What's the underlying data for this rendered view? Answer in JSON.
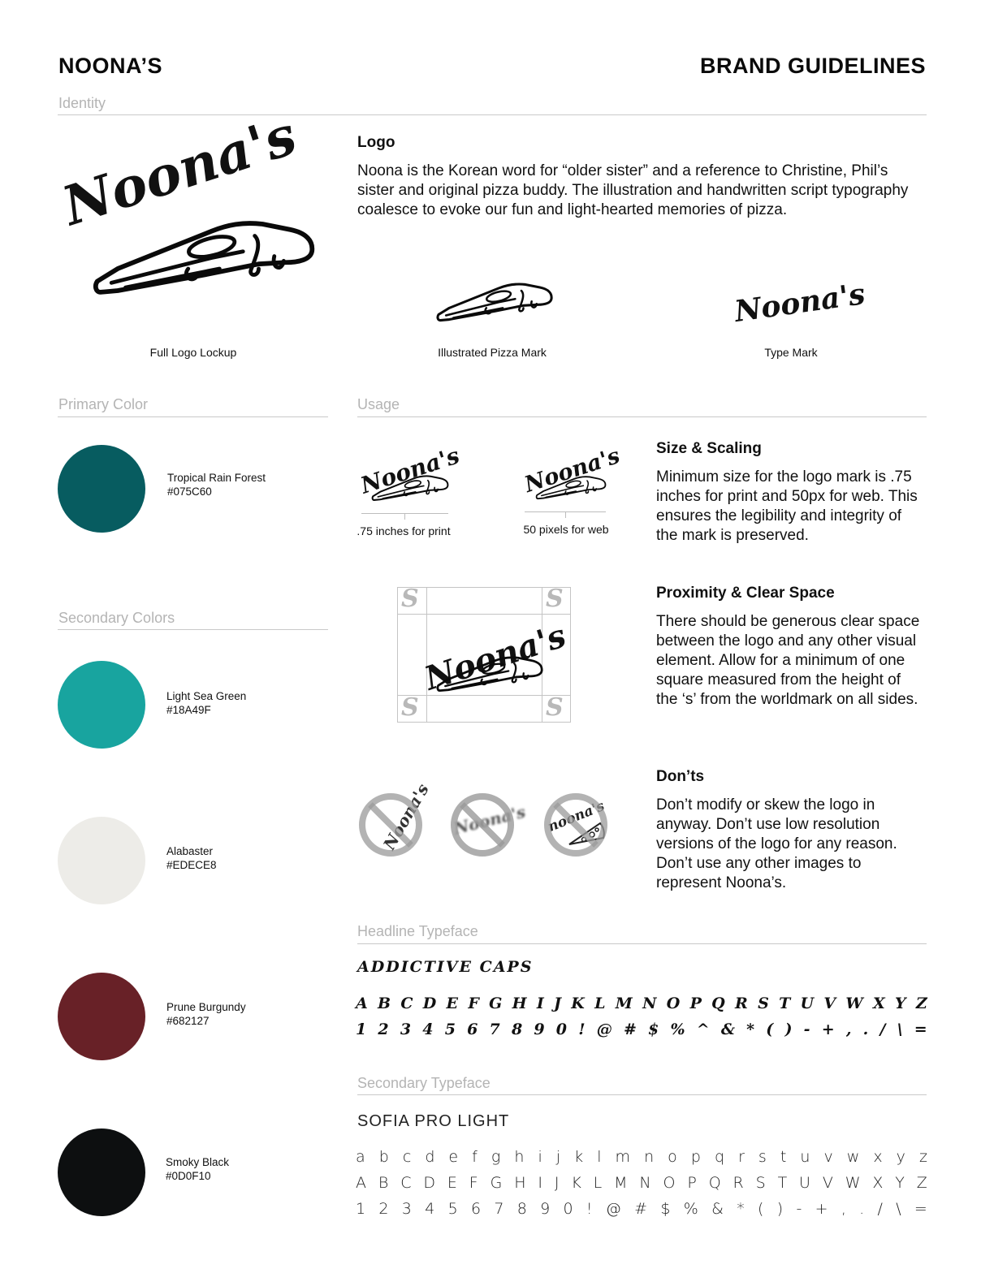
{
  "header": {
    "brand": "NOONA’S",
    "title": "BRAND GUIDELINES"
  },
  "sections": {
    "identity": "Identity",
    "primary_color": "Primary Color",
    "usage": "Usage",
    "secondary_colors": "Secondary Colors",
    "headline_typeface": "Headline Typeface",
    "secondary_typeface": "Secondary Typeface"
  },
  "logo": {
    "heading": "Logo",
    "wordmark": "Noona's",
    "body": "Noona is the Korean word for “older sister” and a reference to Christine, Phil’s sister and original pizza buddy. The illustration and handwritten script typography coalesce to evoke our fun and light-hearted memories of pizza.",
    "captions": {
      "full": "Full Logo Lockup",
      "pizza": "Illustrated Pizza Mark",
      "type": "Type Mark"
    }
  },
  "colors": {
    "primary": [
      {
        "name": "Tropical Rain Forest",
        "hex": "#075C60"
      }
    ],
    "secondary": [
      {
        "name": "Light Sea Green",
        "hex": "#18A49F"
      },
      {
        "name": "Alabaster",
        "hex": "#EDECE8"
      },
      {
        "name": "Prune Burgundy",
        "hex": "#682127"
      },
      {
        "name": "Smoky Black",
        "hex": "#0D0F10"
      }
    ]
  },
  "usage": {
    "print_caption": ".75 inches for print",
    "web_caption": "50 pixels for web",
    "size": {
      "heading": "Size & Scaling",
      "body": "Minimum size for the logo mark is  .75 inches for print and 50px for web. This ensures the legibility and integrity of the mark is preserved."
    },
    "clear": {
      "heading": "Proximity & Clear Space",
      "body": "There should be generous clear space between the logo and any other visual element. Allow for a minimum of one square measured from the height of the ‘s’ from the worldmark on all sides."
    },
    "donts": {
      "heading": "Don’ts",
      "body": "Don’t modify or skew the logo in anyway. Don’t use low resolution versions of the logo for any reason. Don’t use any other images to represent Noona’s.",
      "alt_wordmark": "noona's"
    }
  },
  "typefaces": {
    "headline": {
      "name": "ADDICTIVE CAPS",
      "row1": [
        "A",
        "B",
        "C",
        "D",
        "E",
        "F",
        "G",
        "H",
        "I",
        "J",
        "K",
        "L",
        "M",
        "N",
        "O",
        "P",
        "Q",
        "R",
        "S",
        "T",
        "U",
        "V",
        "W",
        "X",
        "Y",
        "Z"
      ],
      "row2": [
        "1",
        "2",
        "3",
        "4",
        "5",
        "6",
        "7",
        "8",
        "9",
        "0",
        "!",
        "@",
        "#",
        "$",
        "%",
        "^",
        "&",
        "*",
        "(",
        ")",
        "-",
        "+",
        ",",
        ".",
        "/",
        "\\",
        "="
      ]
    },
    "secondary": {
      "name": "SOFIA PRO LIGHT",
      "row1": [
        "a",
        "b",
        "c",
        "d",
        "e",
        "f",
        "g",
        "h",
        "i",
        "j",
        "k",
        "l",
        "m",
        "n",
        "o",
        "p",
        "q",
        "r",
        "s",
        "t",
        "u",
        "v",
        "w",
        "x",
        "y",
        "z"
      ],
      "row2": [
        "A",
        "B",
        "C",
        "D",
        "E",
        "F",
        "G",
        "H",
        "I",
        "J",
        "K",
        "L",
        "M",
        "N",
        "O",
        "P",
        "Q",
        "R",
        "S",
        "T",
        "U",
        "V",
        "W",
        "X",
        "Y",
        "Z"
      ],
      "row3": [
        "1",
        "2",
        "3",
        "4",
        "5",
        "6",
        "7",
        "8",
        "9",
        "0",
        "!",
        "@",
        "#",
        "$",
        "%",
        "&",
        "*",
        "(",
        ")",
        "-",
        "+",
        ",",
        ".",
        "/",
        "\\",
        "="
      ]
    }
  }
}
